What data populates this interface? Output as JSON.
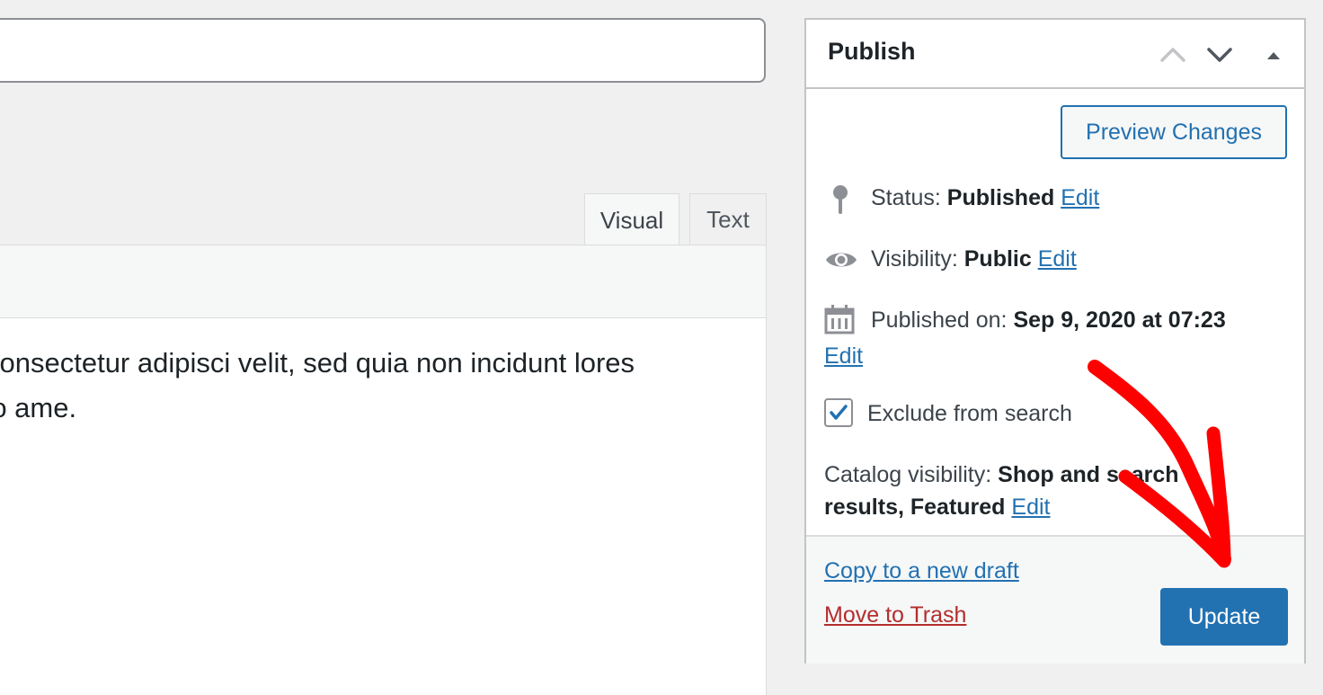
{
  "editor": {
    "tabs": [
      {
        "label": "Visual"
      },
      {
        "label": "Text"
      }
    ],
    "content_lines": [
      "consectetur adipisci velit, sed quia non incidunt lores",
      "ro ame."
    ]
  },
  "publish": {
    "title": "Publish",
    "preview_label": "Preview Changes",
    "status_label": "Status:",
    "status_value": "Published",
    "visibility_label": "Visibility:",
    "visibility_value": "Public",
    "published_label": "Published on:",
    "published_value": "Sep 9, 2020 at 07:23",
    "edit_label": "Edit",
    "exclude_label": "Exclude from search",
    "exclude_checked": true,
    "catalog_label": "Catalog visibility:",
    "catalog_value": "Shop and search results, Featured",
    "copy_label": "Copy to a new draft",
    "trash_label": "Move to Trash",
    "update_label": "Update"
  },
  "colors": {
    "accent": "#2271b1",
    "danger": "#b32d2e",
    "annotation": "#ff0000"
  }
}
